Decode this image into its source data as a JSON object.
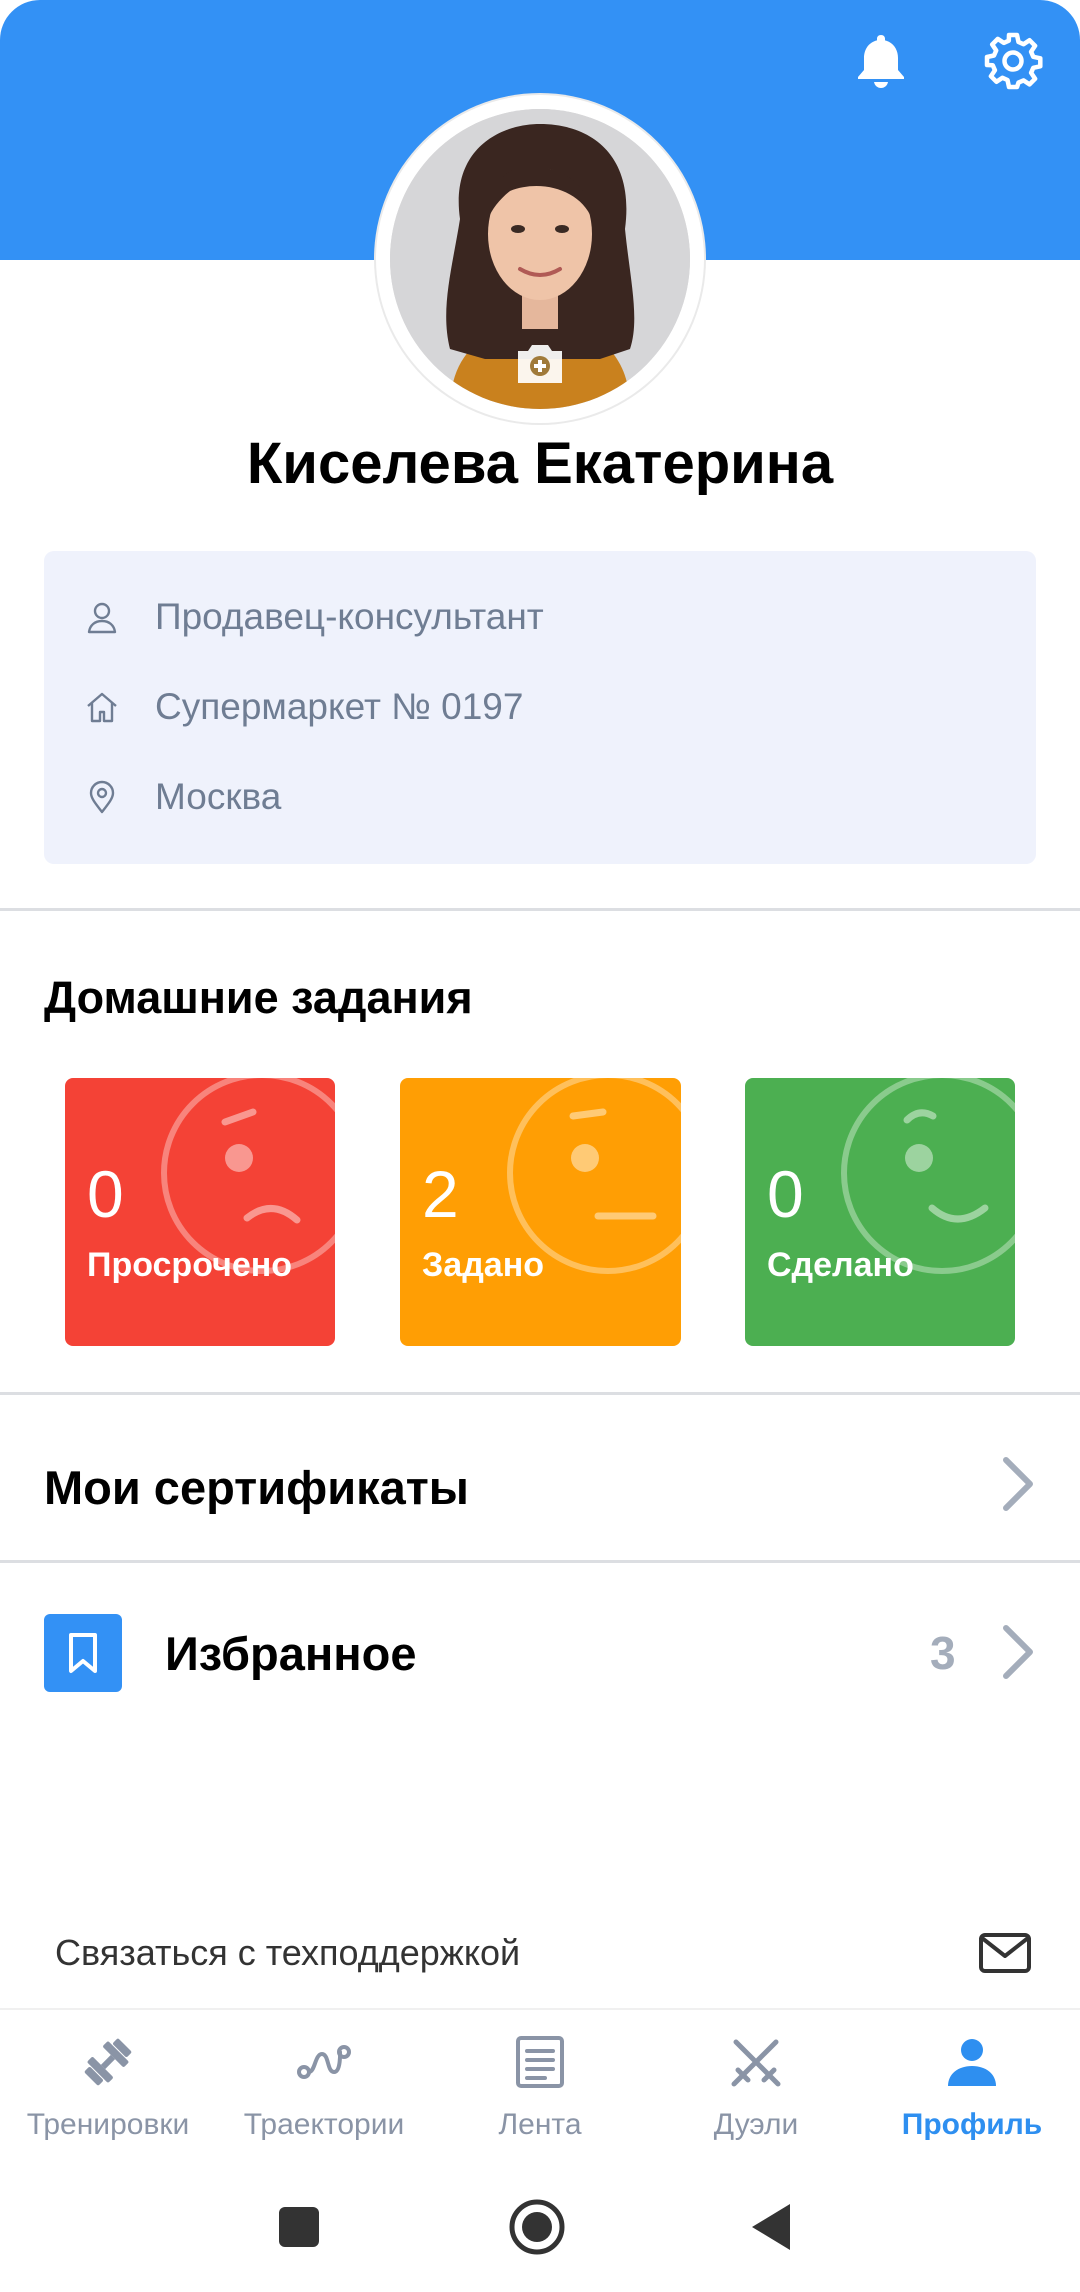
{
  "header": {
    "bell_icon": "bell-icon",
    "settings_icon": "gear-icon",
    "accent_color": "#3391f5"
  },
  "profile": {
    "name": "Киселева Екатерина",
    "avatar_icon": "camera-plus-icon"
  },
  "info": {
    "position": "Продавец-консультант",
    "store": "Супермаркет № 0197",
    "city": "Москва"
  },
  "homework": {
    "title": "Домашние задания",
    "tiles": [
      {
        "count": "0",
        "label": "Просрочено",
        "color": "#f44236"
      },
      {
        "count": "2",
        "label": "Задано",
        "color": "#ff9e04"
      },
      {
        "count": "0",
        "label": "Сделано",
        "color": "#4caf51"
      }
    ]
  },
  "certificates": {
    "title": "Мои сертификаты"
  },
  "favorites": {
    "title": "Избранное",
    "count": "3"
  },
  "support": {
    "label": "Связаться с техподдержкой"
  },
  "nav": {
    "items": [
      {
        "label": "Тренировки",
        "icon": "dumbbell-icon"
      },
      {
        "label": "Траектории",
        "icon": "route-icon"
      },
      {
        "label": "Лента",
        "icon": "feed-icon"
      },
      {
        "label": "Дуэли",
        "icon": "swords-icon"
      },
      {
        "label": "Профиль",
        "icon": "profile-icon"
      }
    ],
    "active_index": 4,
    "active_color": "#2e8ff0"
  }
}
